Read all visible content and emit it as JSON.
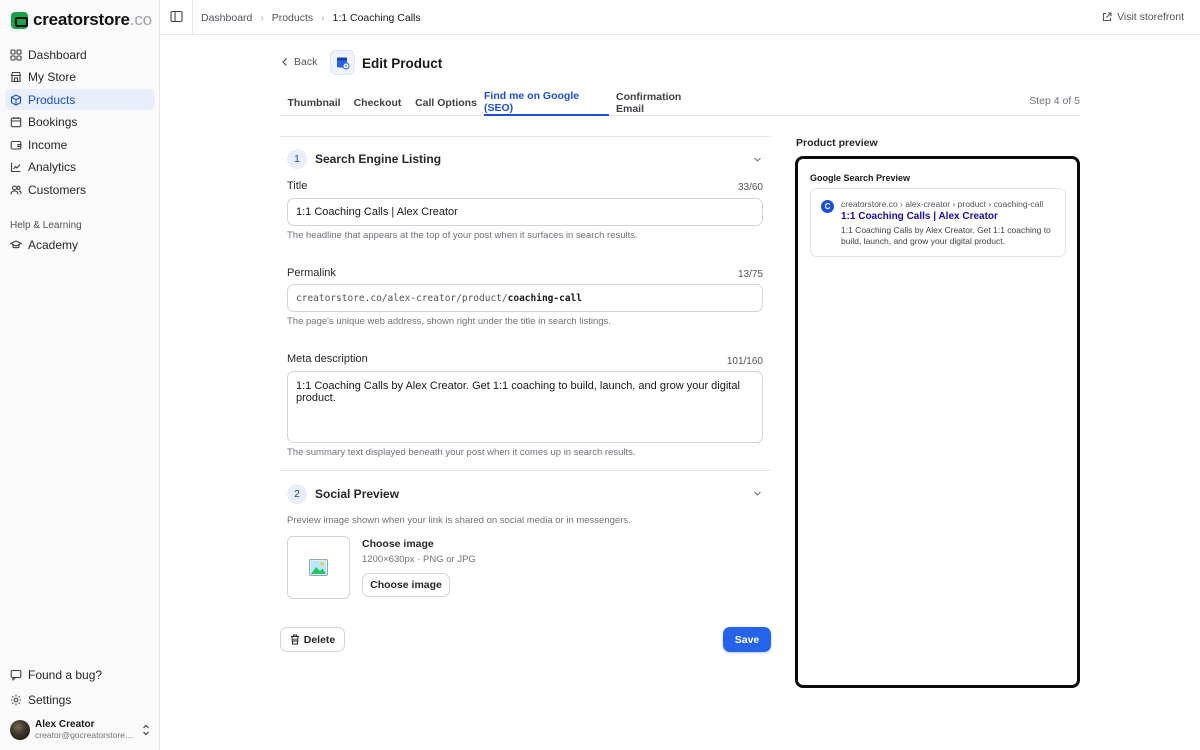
{
  "brand": {
    "name": "creatorstore",
    "suffix": ".co",
    "accent": "#16a34a"
  },
  "sidebar": {
    "items": [
      {
        "label": "Dashboard",
        "icon": "grid-icon"
      },
      {
        "label": "My Store",
        "icon": "store-icon"
      },
      {
        "label": "Products",
        "icon": "box-icon",
        "active": true
      },
      {
        "label": "Bookings",
        "icon": "calendar-icon"
      },
      {
        "label": "Income",
        "icon": "wallet-icon"
      },
      {
        "label": "Analytics",
        "icon": "chart-icon"
      },
      {
        "label": "Customers",
        "icon": "users-icon"
      }
    ],
    "section_title": "Help & Learning",
    "learning_items": [
      {
        "label": "Academy",
        "icon": "graduation-cap-icon"
      }
    ],
    "bottom_items": [
      {
        "label": "Found a bug?",
        "icon": "message-icon"
      },
      {
        "label": "Settings",
        "icon": "gear-icon"
      }
    ],
    "user": {
      "name": "Alex Creator",
      "email": "creator@gocreatorstore.c..."
    }
  },
  "topbar": {
    "breadcrumbs": [
      "Dashboard",
      "Products",
      "1:1 Coaching Calls"
    ],
    "visit_label": "Visit storefront"
  },
  "header": {
    "back_label": "Back",
    "title": "Edit Product"
  },
  "tabs": [
    {
      "label": "Thumbnail"
    },
    {
      "label": "Checkout"
    },
    {
      "label": "Call Options"
    },
    {
      "label": "Find me on Google (SEO)",
      "active": true
    },
    {
      "label": "Confirmation Email"
    }
  ],
  "step_label": "Step 4 of 5",
  "seo": {
    "number": "1",
    "title": "Search Engine Listing",
    "fields": {
      "title": {
        "label": "Title",
        "count": "33/60",
        "value": "1:1 Coaching Calls | Alex Creator",
        "help": "The headline that appears at the top of your post when it surfaces in search results."
      },
      "permalink": {
        "label": "Permalink",
        "count": "13/75",
        "prefix": "creatorstore.co/alex-creator/product/",
        "slug": "coaching-call",
        "help": "The page's unique web address, shown right under the title in search listings."
      },
      "meta": {
        "label": "Meta description",
        "count": "101/160",
        "value": "1:1 Coaching Calls by Alex Creator. Get 1:1 coaching to build, launch, and grow your digital product.",
        "help": "The summary text displayed beneath your post when it comes up in search results."
      }
    }
  },
  "social": {
    "number": "2",
    "title": "Social Preview",
    "description": "Preview image shown when your link is shared on social media or in messengers.",
    "image_title": "Choose image",
    "image_hint": "1200×630px · PNG or JPG",
    "button_label": "Choose image"
  },
  "actions": {
    "delete_label": "Delete",
    "save_label": "Save",
    "primary_color": "#2563eb"
  },
  "preview": {
    "label": "Product preview",
    "heading": "Google Search Preview",
    "favicon_letter": "C",
    "url": "creatorstore.co › alex-creator › product › coaching-call",
    "title": "1:1 Coaching Calls | Alex Creator",
    "description": "1:1 Coaching Calls by Alex Creator. Get 1:1 coaching to build, launch, and grow your digital product."
  }
}
